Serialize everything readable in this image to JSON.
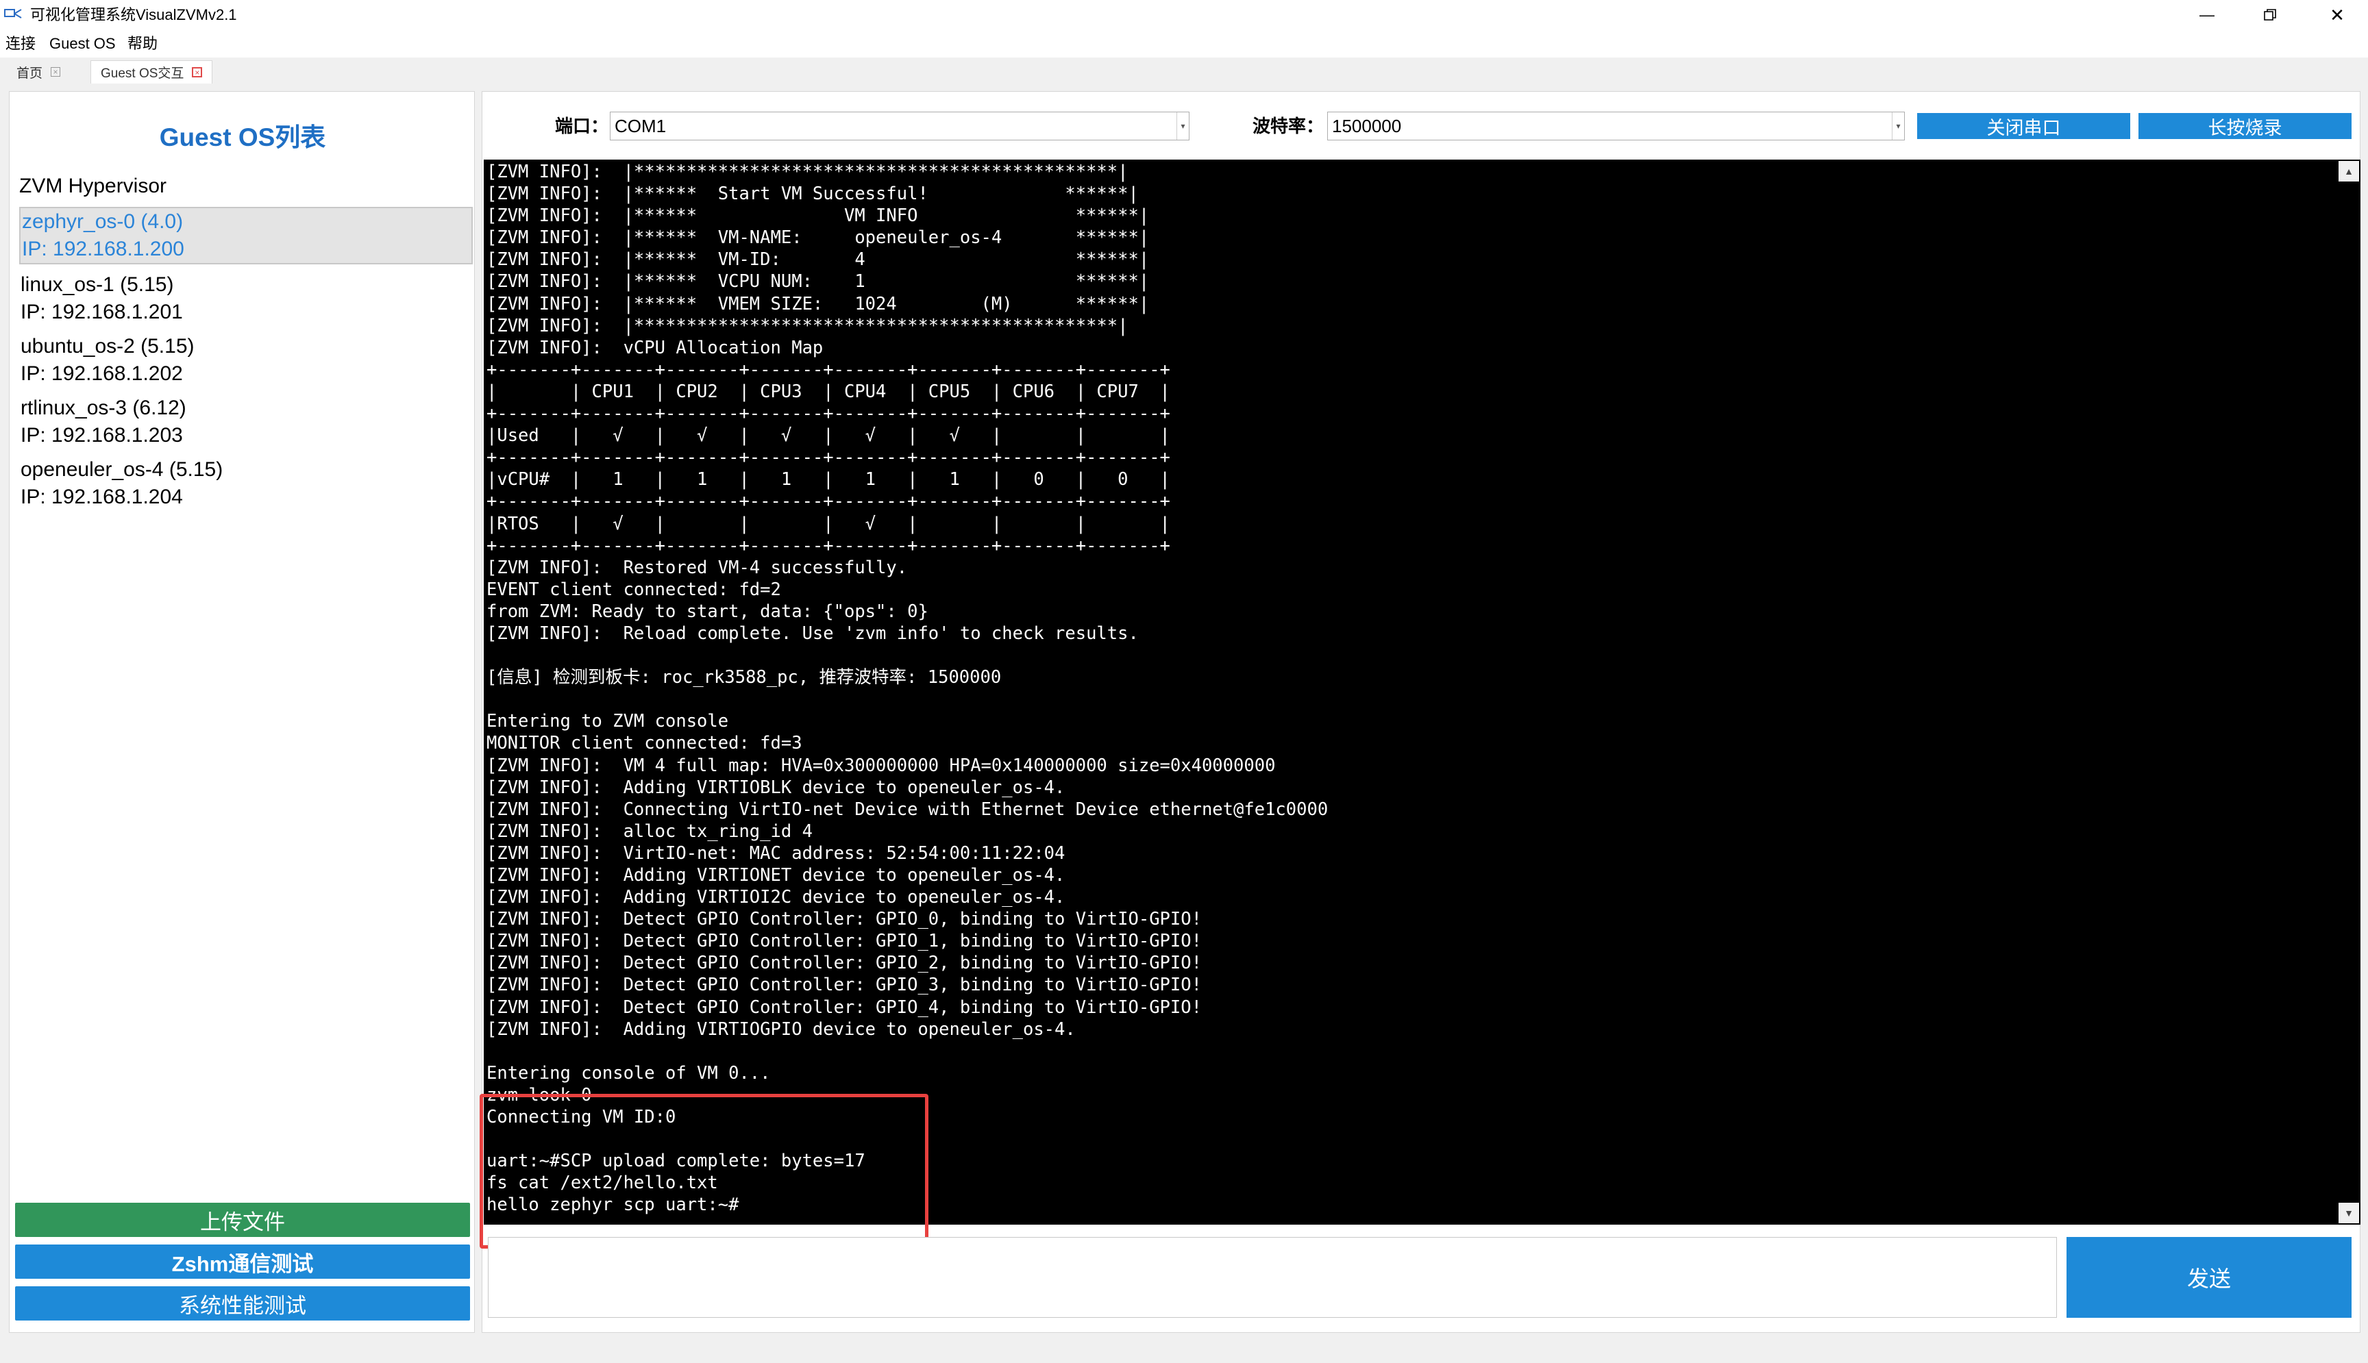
{
  "window": {
    "title": "可视化管理系统VisualZVMv2.1",
    "minimize_glyph": "—",
    "close_glyph": "✕"
  },
  "menu": {
    "items": [
      "连接",
      "Guest OS",
      "帮助"
    ]
  },
  "tabs": [
    {
      "label": "首页",
      "close": "×"
    },
    {
      "label": "Guest OS交互",
      "close": "×"
    }
  ],
  "sidebar": {
    "title": "Guest OS列表",
    "hypervisor": "ZVM Hypervisor",
    "os_list": [
      {
        "name": "zephyr_os-0 (4.0)",
        "ip": "IP: 192.168.1.200",
        "selected": true
      },
      {
        "name": "linux_os-1 (5.15)",
        "ip": "IP: 192.168.1.201"
      },
      {
        "name": "ubuntu_os-2 (5.15)",
        "ip": "IP: 192.168.1.202"
      },
      {
        "name": "rtlinux_os-3 (6.12)",
        "ip": "IP: 192.168.1.203"
      },
      {
        "name": "openeuler_os-4 (5.15)",
        "ip": "IP: 192.168.1.204"
      }
    ],
    "buttons": {
      "upload": "上传文件",
      "zsh_test": "Zshm通信测试",
      "perf_test": "系统性能测试"
    }
  },
  "serial": {
    "port_label": "端口：",
    "port_value": "COM1",
    "baud_label": "波特率：",
    "baud_value": "1500000",
    "close_port_button": "关闭串口",
    "burn_button": "长按烧录",
    "dropdown_glyph": "▾"
  },
  "terminal": {
    "lines": [
      "[ZVM INFO]:  |**********************************************|",
      "[ZVM INFO]:  |******  Start VM Successful!             ******|",
      "[ZVM INFO]:  |******              VM INFO               ******|",
      "[ZVM INFO]:  |******  VM-NAME:     openeuler_os-4       ******|",
      "[ZVM INFO]:  |******  VM-ID:       4                    ******|",
      "[ZVM INFO]:  |******  VCPU NUM:    1                    ******|",
      "[ZVM INFO]:  |******  VMEM SIZE:   1024        (M)      ******|",
      "[ZVM INFO]:  |**********************************************|",
      "[ZVM INFO]:  vCPU Allocation Map",
      "+-------+-------+-------+-------+-------+-------+-------+-------+",
      "|       | CPU1  | CPU2  | CPU3  | CPU4  | CPU5  | CPU6  | CPU7  |",
      "+-------+-------+-------+-------+-------+-------+-------+-------+",
      "|Used   |   √   |   √   |   √   |   √   |   √   |       |       |",
      "+-------+-------+-------+-------+-------+-------+-------+-------+",
      "|vCPU#  |   1   |   1   |   1   |   1   |   1   |   0   |   0   |",
      "+-------+-------+-------+-------+-------+-------+-------+-------+",
      "|RTOS   |   √   |       |       |   √   |       |       |       |",
      "+-------+-------+-------+-------+-------+-------+-------+-------+",
      "[ZVM INFO]:  Restored VM-4 successfully.",
      "EVENT client connected: fd=2",
      "from ZVM: Ready to start, data: {\"ops\": 0}",
      "[ZVM INFO]:  Reload complete. Use 'zvm info' to check results.",
      "",
      "[信息] 检测到板卡: roc_rk3588_pc, 推荐波特率: 1500000",
      "",
      "Entering to ZVM console",
      "MONITOR client connected: fd=3",
      "[ZVM INFO]:  VM 4 full map: HVA=0x300000000 HPA=0x140000000 size=0x40000000",
      "[ZVM INFO]:  Adding VIRTIOBLK device to openeuler_os-4.",
      "[ZVM INFO]:  Connecting VirtIO-net Device with Ethernet Device ethernet@fe1c0000",
      "[ZVM INFO]:  alloc tx_ring_id 4",
      "[ZVM INFO]:  VirtIO-net: MAC address: 52:54:00:11:22:04",
      "[ZVM INFO]:  Adding VIRTIONET device to openeuler_os-4.",
      "[ZVM INFO]:  Adding VIRTIOI2C device to openeuler_os-4.",
      "[ZVM INFO]:  Detect GPIO Controller: GPIO_0, binding to VirtIO-GPIO!",
      "[ZVM INFO]:  Detect GPIO Controller: GPIO_1, binding to VirtIO-GPIO!",
      "[ZVM INFO]:  Detect GPIO Controller: GPIO_2, binding to VirtIO-GPIO!",
      "[ZVM INFO]:  Detect GPIO Controller: GPIO_3, binding to VirtIO-GPIO!",
      "[ZVM INFO]:  Detect GPIO Controller: GPIO_4, binding to VirtIO-GPIO!",
      "[ZVM INFO]:  Adding VIRTIOGPIO device to openeuler_os-4.",
      "",
      "Entering console of VM 0...",
      "zvm look 0",
      "Connecting VM ID:0",
      "",
      "uart:~#SCP upload complete: bytes=17",
      "fs cat /ext2/hello.txt",
      "hello zephyr scp uart:~#"
    ]
  },
  "input": {
    "value": ""
  },
  "send_button": "发送",
  "scroll": {
    "up_glyph": "▲",
    "down_glyph": "▼"
  },
  "colors": {
    "accent_blue": "#1e8ad8",
    "upload_green": "#31965a",
    "highlight_red": "#e8413f",
    "title_blue": "#1f6fc4"
  }
}
